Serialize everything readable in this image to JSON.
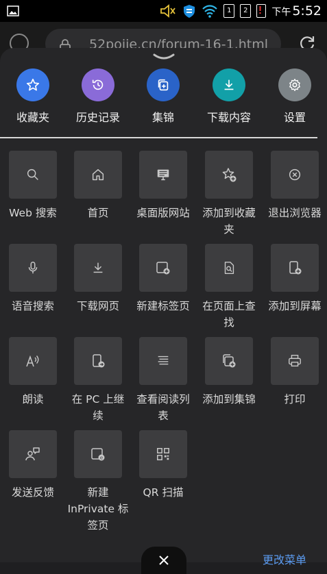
{
  "status_bar": {
    "ampm": "下午",
    "time": "5:52",
    "sim1": "1",
    "sim2": "2"
  },
  "browser": {
    "url": "52pojie.cn/forum-16-1.html"
  },
  "quick_actions": [
    {
      "label": "收藏夹",
      "icon": "star-icon",
      "color": "#3a78e8"
    },
    {
      "label": "历史记录",
      "icon": "history-icon",
      "color": "#8a6bd8"
    },
    {
      "label": "集锦",
      "icon": "collections-icon",
      "color": "#2a63c8"
    },
    {
      "label": "下载内容",
      "icon": "download-icon",
      "color": "#12a0a8"
    },
    {
      "label": "设置",
      "icon": "gear-icon",
      "color": "#7d8488"
    }
  ],
  "menu_items": [
    {
      "label": "Web 搜索",
      "icon": "search-icon"
    },
    {
      "label": "首页",
      "icon": "home-icon"
    },
    {
      "label": "桌面版网站",
      "icon": "desktop-icon"
    },
    {
      "label": "添加到收藏夹",
      "icon": "star-add-icon"
    },
    {
      "label": "退出浏览器",
      "icon": "exit-icon"
    },
    {
      "label": "语音搜索",
      "icon": "microphone-icon"
    },
    {
      "label": "下载网页",
      "icon": "download-page-icon"
    },
    {
      "label": "新建标签页",
      "icon": "new-tab-icon"
    },
    {
      "label": "在页面上查找",
      "icon": "find-in-page-icon"
    },
    {
      "label": "添加到屏幕",
      "icon": "add-to-screen-icon"
    },
    {
      "label": "朗读",
      "icon": "read-aloud-icon"
    },
    {
      "label": "在 PC 上继续",
      "icon": "continue-on-pc-icon"
    },
    {
      "label": "查看阅读列表",
      "icon": "reading-list-icon"
    },
    {
      "label": "添加到集锦",
      "icon": "add-to-collections-icon"
    },
    {
      "label": "打印",
      "icon": "print-icon"
    },
    {
      "label": "发送反馈",
      "icon": "feedback-icon"
    },
    {
      "label": "新建 InPrivate 标签页",
      "icon": "inprivate-tab-icon"
    },
    {
      "label": "QR 扫描",
      "icon": "qr-scan-icon"
    }
  ],
  "footer": {
    "edit_menu": "更改菜单"
  }
}
